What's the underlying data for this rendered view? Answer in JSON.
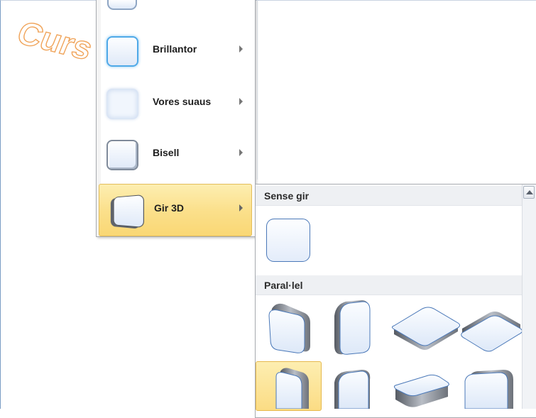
{
  "document": {
    "wordart_text": "Curs d"
  },
  "menu": {
    "items": [
      {
        "label": "Brillantor",
        "icon": "glow-effect-icon"
      },
      {
        "label": "Vores suaus",
        "icon": "soft-edges-effect-icon"
      },
      {
        "label": "Bisell",
        "icon": "bevel-effect-icon"
      },
      {
        "label": "Gir 3D",
        "icon": "rotation-3d-effect-icon",
        "active": true
      }
    ]
  },
  "submenu": {
    "sections": [
      {
        "title": "Sense gir"
      },
      {
        "title": "Paral·lel"
      }
    ]
  },
  "colors": {
    "active_highlight": "#fbe08c",
    "section_header": "#eef0f3",
    "wordart_outline": "#f0a45a",
    "glow": "#4fa9e8"
  }
}
